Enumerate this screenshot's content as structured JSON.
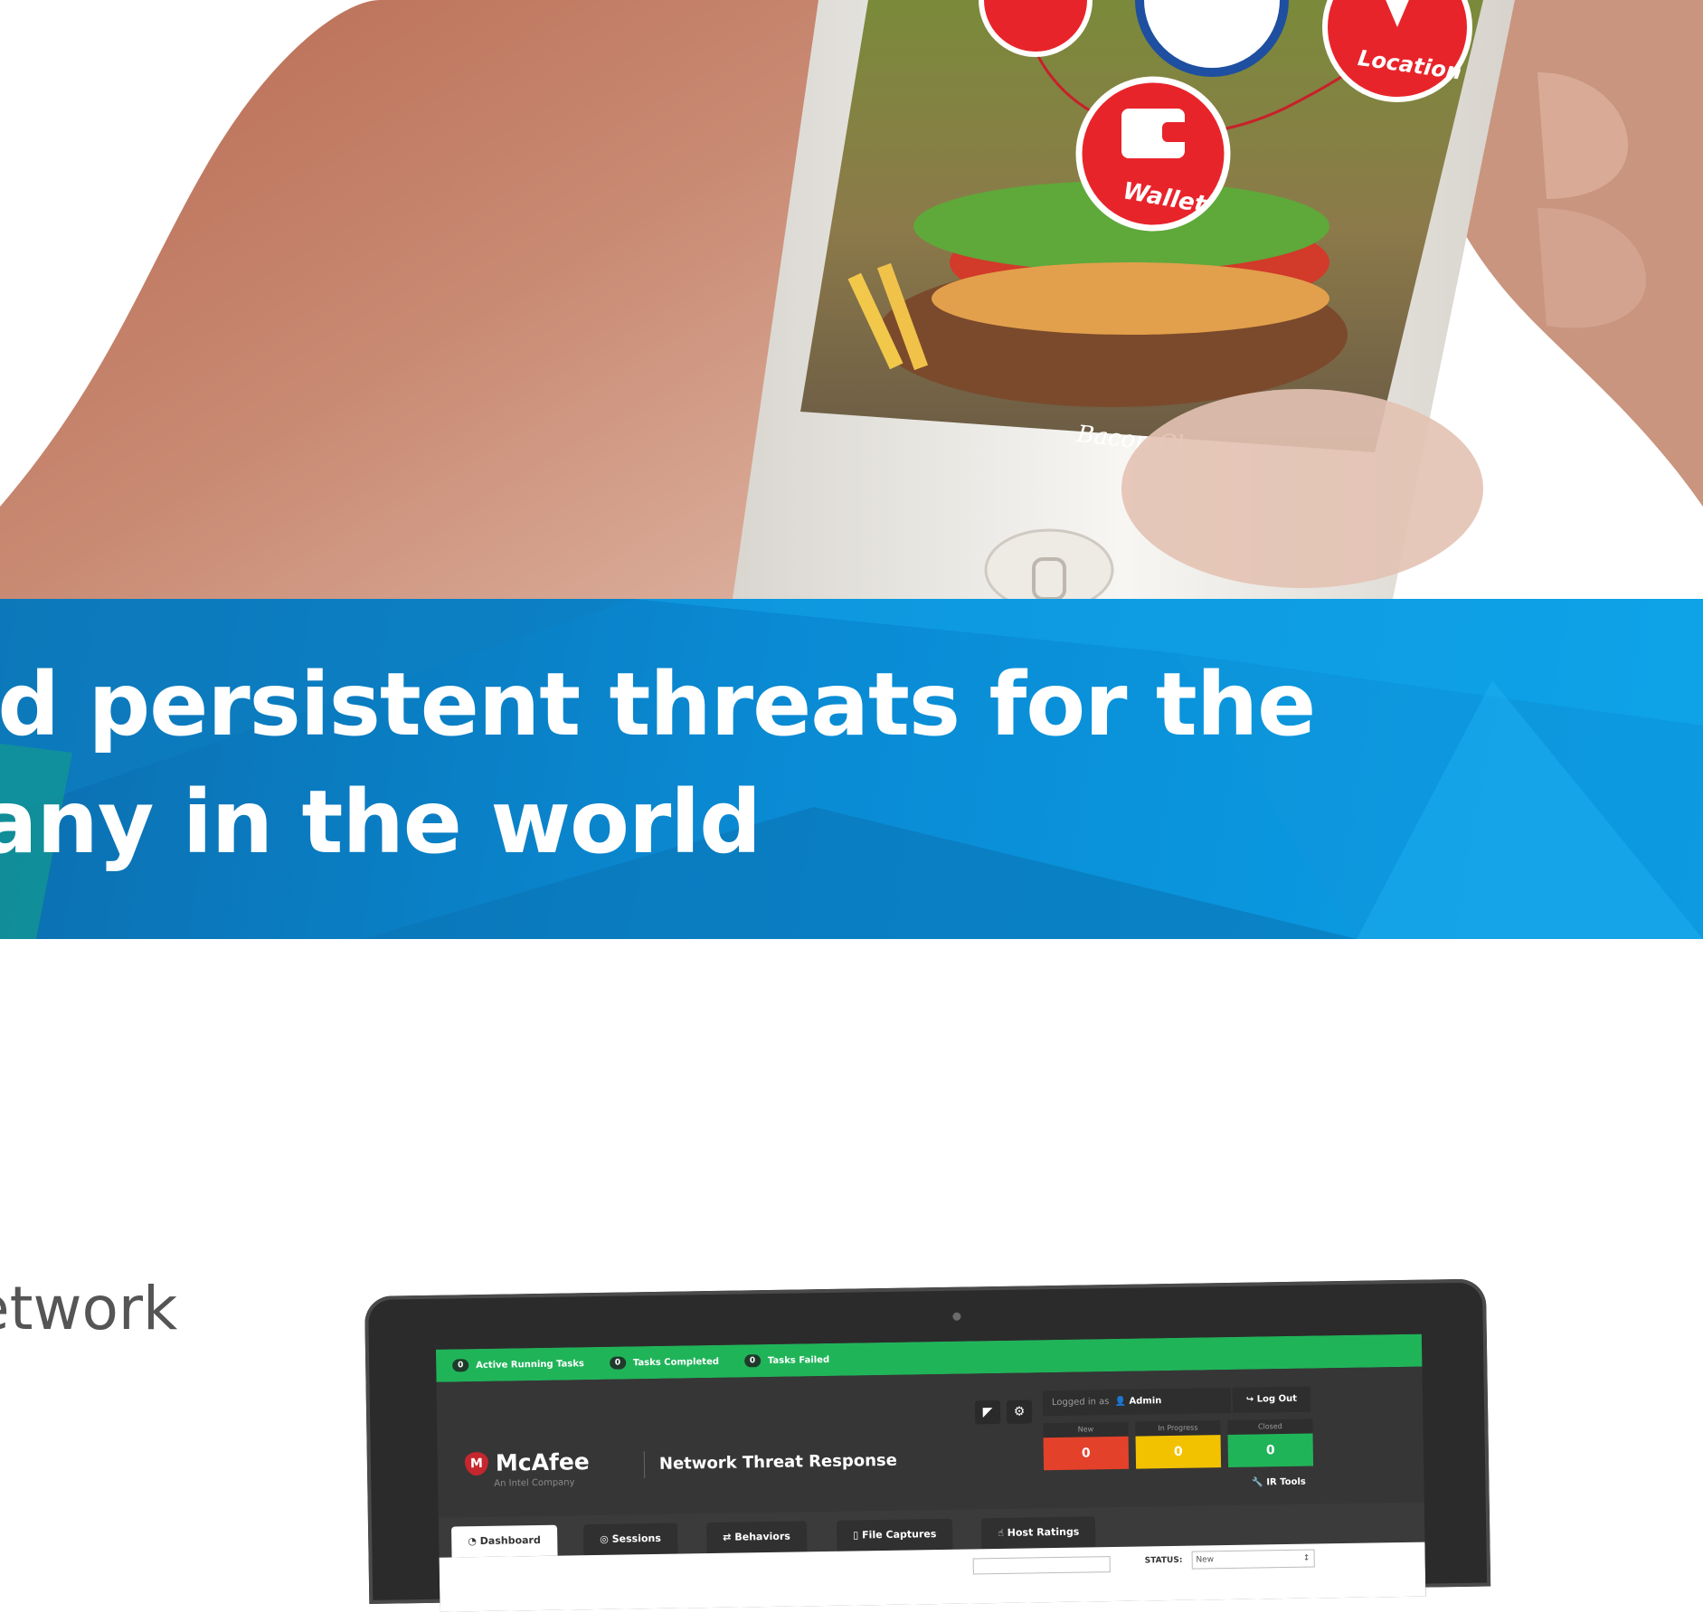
{
  "hero": {
    "app_buttons": [
      {
        "label": "Location"
      },
      {
        "label": "Wallet"
      }
    ],
    "phone_caption": "Bacon Ch",
    "colors": {
      "button_red": "#e8242b",
      "skin": "#c8836a"
    }
  },
  "banner": {
    "line1": "nced persistent threats for the",
    "line2": "mpany in the world",
    "colors": {
      "blue": "#0a8ad3"
    }
  },
  "body_text": {
    "fragment": "etwork"
  },
  "laptop": {
    "status_bar": {
      "items": [
        {
          "count": "0",
          "label": "Active Running Tasks"
        },
        {
          "count": "0",
          "label": "Tasks Completed"
        },
        {
          "count": "0",
          "label": "Tasks Failed"
        }
      ],
      "color": "#20b459"
    },
    "header": {
      "brand": "McAfee",
      "brand_sub": "An Intel Company",
      "product": "Network Threat Response",
      "logged_in_prefix": "Logged in as",
      "user": "Admin",
      "logout": "Log Out",
      "ir_tools": "IR Tools",
      "counters": [
        {
          "label": "New",
          "value": "0",
          "color": "#e4412b"
        },
        {
          "label": "In Progress",
          "value": "0",
          "color": "#f2c200"
        },
        {
          "label": "Closed",
          "value": "0",
          "color": "#20b459"
        }
      ],
      "icons": [
        "rss-icon",
        "gear-icon"
      ]
    },
    "tabs": [
      {
        "label": "Dashboard",
        "active": true,
        "icon": "dashboard-icon"
      },
      {
        "label": "Sessions",
        "active": false,
        "icon": "globe-icon"
      },
      {
        "label": "Behaviors",
        "active": false,
        "icon": "shuffle-icon"
      },
      {
        "label": "File Captures",
        "active": false,
        "icon": "file-icon"
      },
      {
        "label": "Host Ratings",
        "active": false,
        "icon": "thumbs-up-icon"
      }
    ],
    "filter": {
      "label": "STATUS:",
      "value": "New"
    }
  }
}
